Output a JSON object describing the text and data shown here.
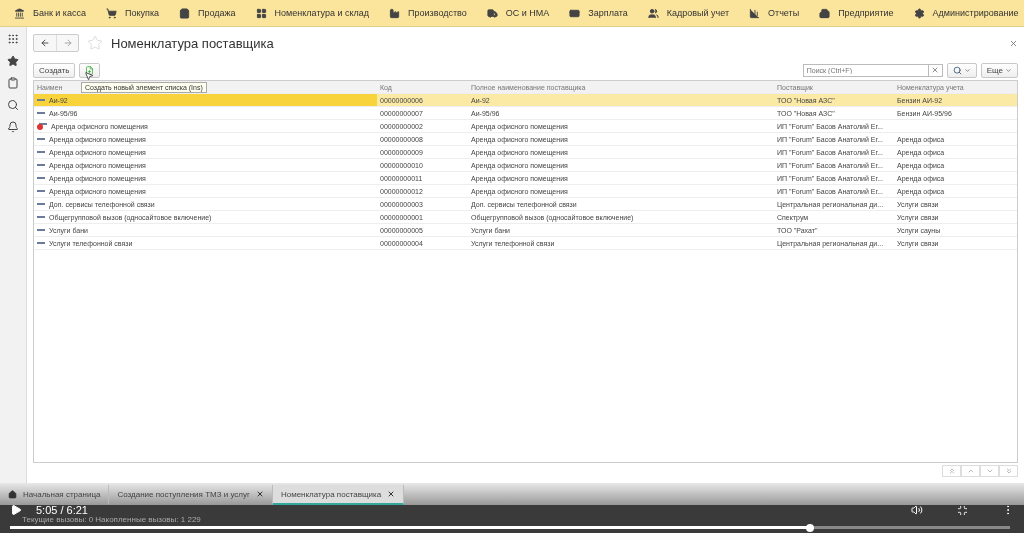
{
  "nav": [
    {
      "label": "Банк и касса"
    },
    {
      "label": "Покупка"
    },
    {
      "label": "Продажа"
    },
    {
      "label": "Номенклатура и склад"
    },
    {
      "label": "Производство"
    },
    {
      "label": "ОС и НМА"
    },
    {
      "label": "Зарплата"
    },
    {
      "label": "Кадровый учет"
    },
    {
      "label": "Отчеты"
    },
    {
      "label": "Предприятие"
    },
    {
      "label": "Администрирование"
    }
  ],
  "form": {
    "title": "Номенклатура поставщика",
    "favorite": false
  },
  "toolbar": {
    "create": "Создать",
    "search_placeholder": "Поиск (Ctrl+F)",
    "more": "Еще",
    "tooltip": "Создать новый элемент списка (Ins)"
  },
  "table": {
    "columns": [
      "Наимен",
      "Код",
      "Полное наименование поставщика",
      "Поставщик",
      "Номенклатура учета"
    ],
    "rows": [
      {
        "name": "Аи-92",
        "code": "00000000006",
        "full_name": "Аи-92",
        "supplier": "ТОО \"Новая АЗС\"",
        "nomenclature": "Бензин АИ-92",
        "selected": true,
        "marked_for_deletion": false
      },
      {
        "name": "Аи-95/96",
        "code": "00000000007",
        "full_name": "Аи-95/96",
        "supplier": "ТОО \"Новая АЗС\"",
        "nomenclature": "Бензин АИ-95/96",
        "selected": false,
        "marked_for_deletion": false
      },
      {
        "name": "Аренда офисного помещения",
        "code": "00000000002",
        "full_name": "Аренда офисного помещения",
        "supplier": "ИП \"Forum\" Басов Анатолий Ег...",
        "selected": false,
        "marked_for_deletion": true
      },
      {
        "name": "Аренда офисного помещения",
        "code": "00000000008",
        "full_name": "Аренда офисного помещения",
        "supplier": "ИП \"Forum\" Басов Анатолий Ег...",
        "nomenclature": "Аренда офиса",
        "selected": false,
        "marked_for_deletion": false
      },
      {
        "name": "Аренда офисного помещения",
        "code": "00000000009",
        "full_name": "Аренда офисного помещения",
        "supplier": "ИП \"Forum\" Басов Анатолий Ег...",
        "nomenclature": "Аренда офиса",
        "selected": false,
        "marked_for_deletion": false
      },
      {
        "name": "Аренда офисного помещения",
        "code": "00000000010",
        "full_name": "Аренда офисного помещения",
        "supplier": "ИП \"Forum\" Басов Анатолий Ег...",
        "nomenclature": "Аренда офиса",
        "selected": false,
        "marked_for_deletion": false
      },
      {
        "name": "Аренда офисного помещения",
        "code": "00000000011",
        "full_name": "Аренда офисного помещения",
        "supplier": "ИП \"Forum\" Басов Анатолий Ег...",
        "nomenclature": "Аренда офиса",
        "selected": false,
        "marked_for_deletion": false
      },
      {
        "name": "Аренда офисного помещения",
        "code": "00000000012",
        "full_name": "Аренда офисного помещения",
        "supplier": "ИП \"Forum\" Басов Анатолий Ег...",
        "nomenclature": "Аренда офиса",
        "selected": false,
        "marked_for_deletion": false
      },
      {
        "name": "Доп. сервисы телефонной связи",
        "code": "00000000003",
        "full_name": "Доп. сервисы телефонной связи",
        "supplier": "Центральная региональная ди...",
        "nomenclature": "Услуги связи",
        "selected": false,
        "marked_for_deletion": false
      },
      {
        "name": "Общегрупповой вызов  (односайтовое включение)",
        "code": "00000000001",
        "full_name": "Общегрупповой вызов  (односайтовое включение)",
        "supplier": "Спектрум",
        "nomenclature": "Услуги связи",
        "selected": false,
        "marked_for_deletion": false
      },
      {
        "name": "Услуги бани",
        "code": "00000000005",
        "full_name": "Услуги бани",
        "supplier": "ТОО \"Рахат\"",
        "nomenclature": "Услуги сауны",
        "selected": false,
        "marked_for_deletion": false
      },
      {
        "name": "Услуги телефонной связи",
        "code": "00000000004",
        "full_name": "Услуги телефонной связи",
        "supplier": "Центральная региональная ди...",
        "nomenclature": "Услуги связи",
        "selected": false,
        "marked_for_deletion": false
      }
    ]
  },
  "open_tabs": [
    {
      "label": "Начальная страница",
      "kind": "home",
      "selected": false
    },
    {
      "label": "Создание поступления ТМЗ и услуг",
      "kind": "closable",
      "selected": false
    },
    {
      "label": "Номенклатура поставщика",
      "kind": "closable",
      "selected": true
    }
  ],
  "status_bar": "Текущие вызовы: 0   Накопленные вызовы: 1 229",
  "video": {
    "time": "5:05 / 6:21",
    "level": 0.8
  }
}
